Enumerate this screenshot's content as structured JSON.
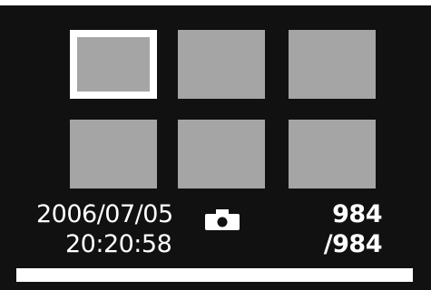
{
  "thumbnails": {
    "selected_index": 0,
    "items": [
      {
        "selected": true
      },
      {
        "selected": false
      },
      {
        "selected": false
      },
      {
        "selected": false
      },
      {
        "selected": false
      },
      {
        "selected": false
      }
    ]
  },
  "info": {
    "date": "2006/07/05",
    "time": "20:20:58",
    "current_count": "984",
    "total_count": "/984",
    "mode_icon": "camera-icon"
  },
  "progress": {
    "fraction": 1.0
  },
  "colors": {
    "background": "#111111",
    "thumbnail": "#a5a5a5",
    "selection": "#ffffff",
    "text": "#ffffff"
  }
}
